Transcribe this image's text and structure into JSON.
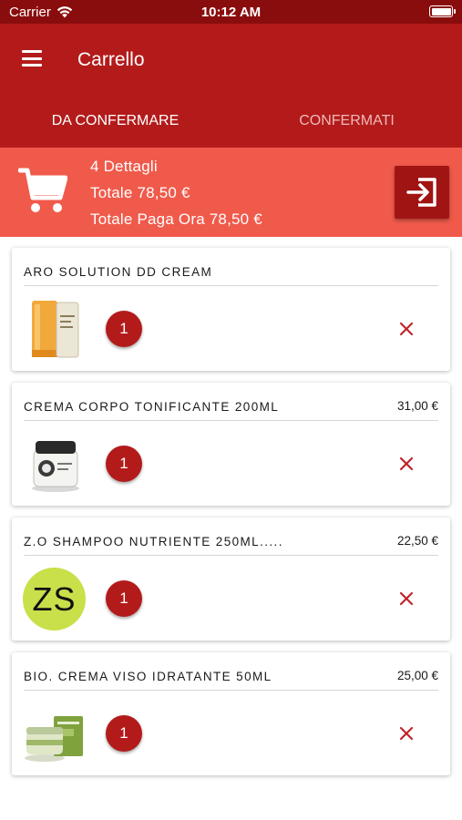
{
  "status_bar": {
    "carrier": "Carrier",
    "time": "10:12 AM",
    "wifi_icon": "wifi-icon",
    "battery_icon": "battery-full-icon"
  },
  "app_bar": {
    "title": "Carrello",
    "menu_icon": "hamburger-menu-icon"
  },
  "tabs": [
    {
      "label": "DA CONFERMARE",
      "active": true
    },
    {
      "label": "CONFERMATI",
      "active": false
    }
  ],
  "summary": {
    "details": "4 Dettagli",
    "total": "Totale 78,50 €",
    "total_pay_now": "Totale Paga Ora 78,50 €",
    "cart_icon": "shopping-cart-icon",
    "checkout_icon": "sign-in-arrow-icon"
  },
  "items": [
    {
      "name": "ARO SOLUTION DD CREAM",
      "price": "",
      "quantity": "1",
      "image": "product-image-tubes"
    },
    {
      "name": "CREMA CORPO TONIFICANTE 200ML",
      "price": "31,00 €",
      "quantity": "1",
      "image": "product-image-jar"
    },
    {
      "name": "Z.O SHAMPOO NUTRIENTE 250ML.....",
      "price": "22,50 €",
      "quantity": "1",
      "image": "initials-avatar",
      "initials": "ZS"
    },
    {
      "name": "BIO. CREMA VISO IDRATANTE 50ML",
      "price": "25,00 €",
      "quantity": "1",
      "image": "product-image-green-jar"
    }
  ],
  "colors": {
    "status_bar": "#8a0d0d",
    "primary": "#b31b1b",
    "summary_bg": "#f05a4b",
    "checkout_button": "#a11414",
    "tab_inactive_text": "#f0b9b9",
    "avatar_bg": "#c9e04a"
  }
}
